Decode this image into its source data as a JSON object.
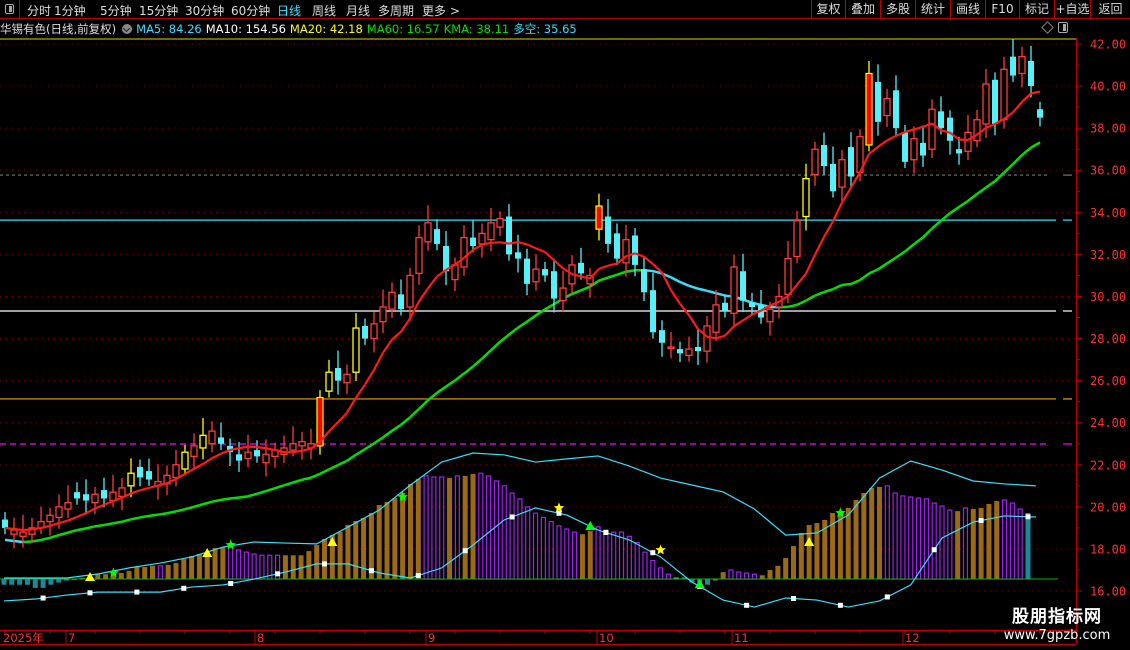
{
  "menu": {
    "periods": [
      "分时",
      "1分钟",
      "5分钟",
      "15分钟",
      "30分钟",
      "60分钟",
      "日线",
      "周线",
      "月线",
      "多周期",
      "更多 >"
    ],
    "active_period": "日线",
    "right_buttons": [
      "复权",
      "叠加",
      "多股",
      "统计",
      "画线",
      "F10",
      "标记",
      "+自选",
      "返回"
    ]
  },
  "info": {
    "title": "华锡有色(日线,前复权)",
    "indicators": [
      {
        "text": "MA5: 84.26",
        "color": "#33e0ff"
      },
      {
        "text": "MA10: 154.56",
        "color": "#ffffff"
      },
      {
        "text": "MA20: 42.18",
        "color": "#ffff00"
      },
      {
        "text": "MA60: 16.57",
        "color": "#00e000"
      },
      {
        "text": "KMA: 38.11",
        "color": "#00e000"
      },
      {
        "text": "多空: 35.65",
        "color": "#33e0ff"
      }
    ]
  },
  "watermark": {
    "line1": "股朋指标网",
    "line2": "www.7gpzb.com"
  },
  "chart_data": {
    "type": "candlestick",
    "ylim": [
      16,
      42
    ],
    "y_ticks": [
      "42.00",
      "40.00",
      "38.00",
      "36.00",
      "34.00",
      "32.00",
      "30.00",
      "28.00",
      "26.00",
      "24.00",
      "22.00",
      "20.00",
      "18.00",
      "16.00"
    ],
    "x_labels": [
      {
        "label": "2025年",
        "candle": 0
      },
      {
        "label": "7",
        "candle": 7
      },
      {
        "label": "8",
        "candle": 28
      },
      {
        "label": "9",
        "candle": 47
      },
      {
        "label": "10",
        "candle": 66
      },
      {
        "label": "11",
        "candle": 81
      },
      {
        "label": "12",
        "candle": 100
      }
    ],
    "open": [
      19.4,
      18.7,
      18.6,
      18.7,
      19.0,
      19.3,
      19.5,
      19.9,
      20.7,
      20.6,
      20.2,
      20.8,
      20.3,
      20.5,
      21.0,
      21.9,
      21.7,
      21.0,
      21.1,
      21.4,
      21.8,
      22.4,
      22.8,
      23.0,
      23.3,
      22.9,
      22.5,
      22.3,
      22.7,
      22.1,
      22.4,
      22.5,
      22.7,
      22.9,
      22.8,
      22.9,
      25.5,
      26.6,
      25.9,
      26.4,
      28.6,
      28.0,
      28.8,
      29.4,
      30.1,
      29.5,
      31.1,
      32.6,
      33.2,
      32.4,
      30.8,
      31.4,
      32.8,
      32.5,
      32.7,
      33.3,
      33.8,
      32.1,
      31.8,
      30.7,
      31.3,
      31.2,
      29.8,
      30.6,
      31.6,
      30.6,
      33.2,
      33.8,
      33.0,
      31.6,
      32.9,
      31.3,
      30.3,
      28.4,
      27.6,
      27.5,
      27.2,
      27.6,
      27.4,
      28.3,
      29.7,
      29.2,
      31.2,
      29.7,
      29.6,
      28.8,
      29.5,
      30.1,
      31.9,
      33.8,
      35.8,
      37.2,
      36.3,
      35.2,
      37.1,
      35.9,
      37.2,
      40.2,
      38.6,
      39.8,
      37.8,
      36.5,
      37.3,
      37.0,
      38.8,
      38.5,
      37.0,
      36.9,
      37.4,
      38.2,
      40.3,
      38.4,
      41.4,
      40.6,
      41.2,
      38.9
    ],
    "close": [
      19.0,
      18.9,
      18.8,
      19.0,
      19.3,
      19.6,
      20.0,
      20.2,
      20.4,
      20.3,
      20.6,
      20.4,
      20.7,
      20.9,
      21.6,
      21.4,
      21.3,
      21.2,
      21.5,
      22.0,
      22.6,
      22.9,
      23.4,
      23.6,
      23.0,
      22.6,
      22.2,
      22.6,
      22.4,
      22.5,
      22.7,
      22.8,
      23.0,
      23.1,
      23.0,
      25.2,
      26.4,
      26.0,
      26.3,
      28.5,
      28.0,
      28.7,
      29.5,
      30.2,
      29.4,
      31.0,
      32.8,
      33.5,
      32.5,
      31.2,
      31.5,
      32.8,
      32.4,
      33.0,
      33.5,
      33.7,
      32.0,
      31.8,
      30.6,
      31.3,
      31.0,
      29.9,
      30.4,
      31.5,
      31.1,
      31.0,
      34.3,
      32.5,
      31.8,
      32.7,
      31.5,
      30.2,
      28.3,
      27.8,
      27.6,
      27.3,
      27.5,
      27.4,
      28.6,
      29.6,
      29.3,
      31.4,
      29.8,
      29.5,
      29.0,
      29.4,
      30.0,
      31.8,
      33.6,
      35.6,
      37.0,
      36.2,
      35.0,
      36.5,
      35.7,
      37.6,
      40.6,
      38.3,
      39.4,
      38.0,
      36.4,
      37.5,
      36.7,
      38.9,
      38.0,
      37.4,
      36.8,
      37.8,
      38.4,
      40.1,
      38.2,
      40.8,
      40.5,
      41.4,
      40.0,
      38.5
    ],
    "limit_up_hollow": [
      14,
      20,
      22,
      36,
      39,
      89
    ],
    "limit_up_filled": [
      35,
      66,
      96
    ],
    "ma_short_period": 8,
    "ma_long_period": 28,
    "reference_lines": [
      {
        "value": 35.77,
        "color": "#777777",
        "style": "dashed"
      },
      {
        "value": 33.63,
        "color": "#33e0ff",
        "style": "solid"
      },
      {
        "value": 29.31,
        "color": "#ffffff",
        "style": "solid"
      },
      {
        "value": 25.13,
        "color": "#ff9900",
        "style": "solid"
      },
      {
        "value": 22.99,
        "color": "#ff00ff",
        "style": "dashed"
      }
    ],
    "oscillator": {
      "baseline": 16.57,
      "bar_types": "TTTTTTTTTTOOOOOOOOOOPOOOOOOOOPPPPPPPOOOOOOOOOOOOOOOOOOPPPOPOOPPPPPPPPPPPPPOOPPPPPPPPPPGTTTTOOPPPPOOOOOOOOOOOOOOOOPPPPPPPPPOPOOOOPPP",
      "bars": [
        16.3,
        16.3,
        16.3,
        16.3,
        16.15,
        16.15,
        16.3,
        16.4,
        16.5,
        16.55,
        16.62,
        16.65,
        16.8,
        16.8,
        16.86,
        16.86,
        16.95,
        17.14,
        17.14,
        17.2,
        17.2,
        17.24,
        17.33,
        17.52,
        17.67,
        17.76,
        17.85,
        18.05,
        18.09,
        18.09,
        17.95,
        17.85,
        17.76,
        17.7,
        17.7,
        17.7,
        17.7,
        17.7,
        17.7,
        17.9,
        18.19,
        18.47,
        18.66,
        18.81,
        19.14,
        19.33,
        19.47,
        19.71,
        20.09,
        20.23,
        20.42,
        20.66,
        21.09,
        21.33,
        21.47,
        21.42,
        21.42,
        21.38,
        21.47,
        21.47,
        21.56,
        21.6,
        21.47,
        21.23,
        21.0,
        20.66,
        20.38,
        20.0,
        19.7,
        19.5,
        19.3,
        19.1,
        18.95,
        18.8,
        18.7,
        18.85,
        19.05,
        18.9,
        18.8,
        18.8,
        18.6,
        18.3,
        17.85,
        17.45,
        17.1,
        16.8,
        16.62,
        16.65,
        16.4,
        16.4,
        16.3,
        16.5,
        16.9,
        17.0,
        16.9,
        16.85,
        16.8,
        16.75,
        17.0,
        17.2,
        17.57,
        18.14,
        18.76,
        19.14,
        19.23,
        19.38,
        19.71,
        19.76,
        19.95,
        20.33,
        20.66,
        20.9,
        20.95,
        21.0,
        20.66,
        20.52,
        20.47,
        20.42,
        20.38,
        20.18,
        20.04,
        19.85,
        19.8,
        19.95,
        19.9,
        19.95,
        20.14,
        20.28,
        20.33,
        20.18,
        19.9,
        19.71
      ],
      "upper_curve": [
        16.62,
        16.62,
        16.62,
        16.81,
        17.1,
        17.33,
        17.62,
        18.09,
        18.33,
        18.28,
        18.24,
        19.04,
        19.85,
        21.04,
        22.13,
        22.56,
        22.47,
        22.13,
        22.28,
        22.42,
        21.94,
        21.37,
        21.04,
        20.71,
        19.9,
        18.66,
        18.76,
        19.61,
        21.37,
        22.18,
        21.75,
        21.23,
        21.09,
        21.0
      ],
      "lower_curve": [
        15.53,
        15.62,
        15.81,
        15.95,
        15.95,
        15.95,
        16.19,
        16.29,
        16.57,
        16.9,
        17.29,
        17.29,
        16.86,
        16.62,
        17.1,
        18.19,
        19.38,
        19.95,
        19.61,
        18.9,
        18.43,
        17.62,
        16.43,
        15.57,
        15.24,
        15.67,
        15.57,
        15.24,
        15.53,
        16.29,
        18.52,
        19.28,
        19.57,
        19.52
      ],
      "curve_step": 4,
      "markers": [
        {
          "bar": 11,
          "value": 16.67,
          "type": "triangle",
          "color": "#ffff00"
        },
        {
          "bar": 14,
          "value": 16.86,
          "type": "star",
          "color": "#00ff00"
        },
        {
          "bar": 26,
          "value": 17.81,
          "type": "triangle",
          "color": "#ffff00"
        },
        {
          "bar": 29,
          "value": 18.19,
          "type": "star",
          "color": "#00ff00"
        },
        {
          "bar": 42,
          "value": 18.33,
          "type": "triangle",
          "color": "#ffff00"
        },
        {
          "bar": 51,
          "value": 20.47,
          "type": "star",
          "color": "#00ff00"
        },
        {
          "bar": 71,
          "value": 19.95,
          "type": "star",
          "color": "#ffff00"
        },
        {
          "bar": 75,
          "value": 19.09,
          "type": "triangle",
          "color": "#00ff00"
        },
        {
          "bar": 84,
          "value": 17.95,
          "type": "star",
          "color": "#ffff00"
        },
        {
          "bar": 89,
          "value": 16.33,
          "type": "triangle",
          "color": "#00ff00"
        },
        {
          "bar": 103,
          "value": 18.33,
          "type": "triangle",
          "color": "#ffff00"
        },
        {
          "bar": 107,
          "value": 19.71,
          "type": "star",
          "color": "#00ff00"
        }
      ]
    }
  }
}
